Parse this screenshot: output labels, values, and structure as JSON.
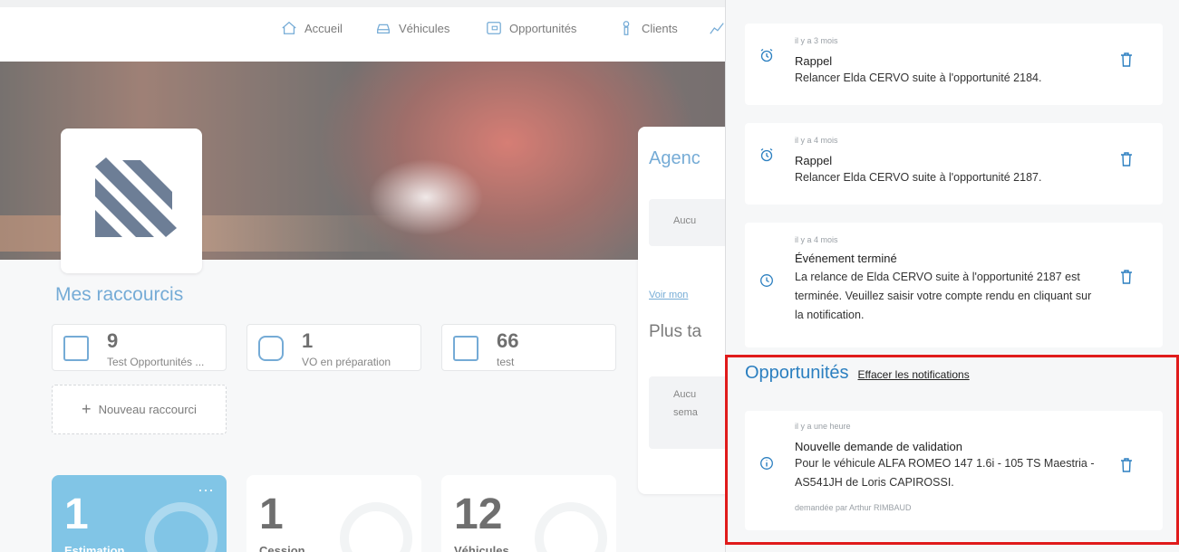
{
  "nav": {
    "items": [
      {
        "label": "Accueil",
        "icon": "home-icon"
      },
      {
        "label": "Véhicules",
        "icon": "car-icon"
      },
      {
        "label": "Opportunités",
        "icon": "wallet-icon"
      },
      {
        "label": "Clients",
        "icon": "user-icon"
      }
    ]
  },
  "shortcuts": {
    "title": "Mes raccourcis",
    "items": [
      {
        "count": "9",
        "label": "Test Opportunités ...",
        "icon": "wallet-icon"
      },
      {
        "count": "1",
        "label": "VO en préparation",
        "icon": "car-icon"
      },
      {
        "count": "66",
        "label": "test",
        "icon": "wallet-icon"
      }
    ],
    "new_label": "Nouveau raccourci",
    "new_plus": "+"
  },
  "agenda": {
    "title": "Agenc",
    "none_1": "Aucu",
    "link": "Voir mon",
    "later": "Plus ta",
    "none_2_line1": "Aucu",
    "none_2_line2": "sema"
  },
  "stats": [
    {
      "value": "1",
      "caption": "Estimation",
      "more": "···"
    },
    {
      "value": "1",
      "caption": "Cession"
    },
    {
      "value": "12",
      "caption": "Véhicules"
    }
  ],
  "notifications": {
    "reminders": [
      {
        "time": "il y a 3 mois",
        "title": "Rappel",
        "body": "Relancer Elda CERVO suite à l'opportunité 2184.",
        "icon": "alarm-clock-icon"
      },
      {
        "time": "il y a 4 mois",
        "title": "Rappel",
        "body": "Relancer Elda CERVO suite à l'opportunité 2187.",
        "icon": "alarm-clock-icon"
      },
      {
        "time": "il y a 4 mois",
        "title": "Événement terminé",
        "body_lines": [
          "La relance de Elda CERVO suite à l'opportunité 2187 est",
          "terminée. Veuillez saisir votre compte rendu en cliquant sur",
          "la notification."
        ],
        "icon": "clock-icon"
      }
    ],
    "opportunities": {
      "title": "Opportunités",
      "clear_label": "Effacer les notifications",
      "item": {
        "time": "il y a une heure",
        "title": "Nouvelle demande de validation",
        "body_lines": [
          "Pour le véhicule ALFA ROMEO 147 1.6i - 105 TS Maestria -",
          "AS541JH de Loris CAPIROSSI."
        ],
        "by": "demandée par Arthur RIMBAUD",
        "icon": "info-icon"
      }
    }
  },
  "colors": {
    "accent": "#2b7fc0",
    "highlight": "#e01b1b",
    "stat_blue": "#3ea7d9"
  }
}
